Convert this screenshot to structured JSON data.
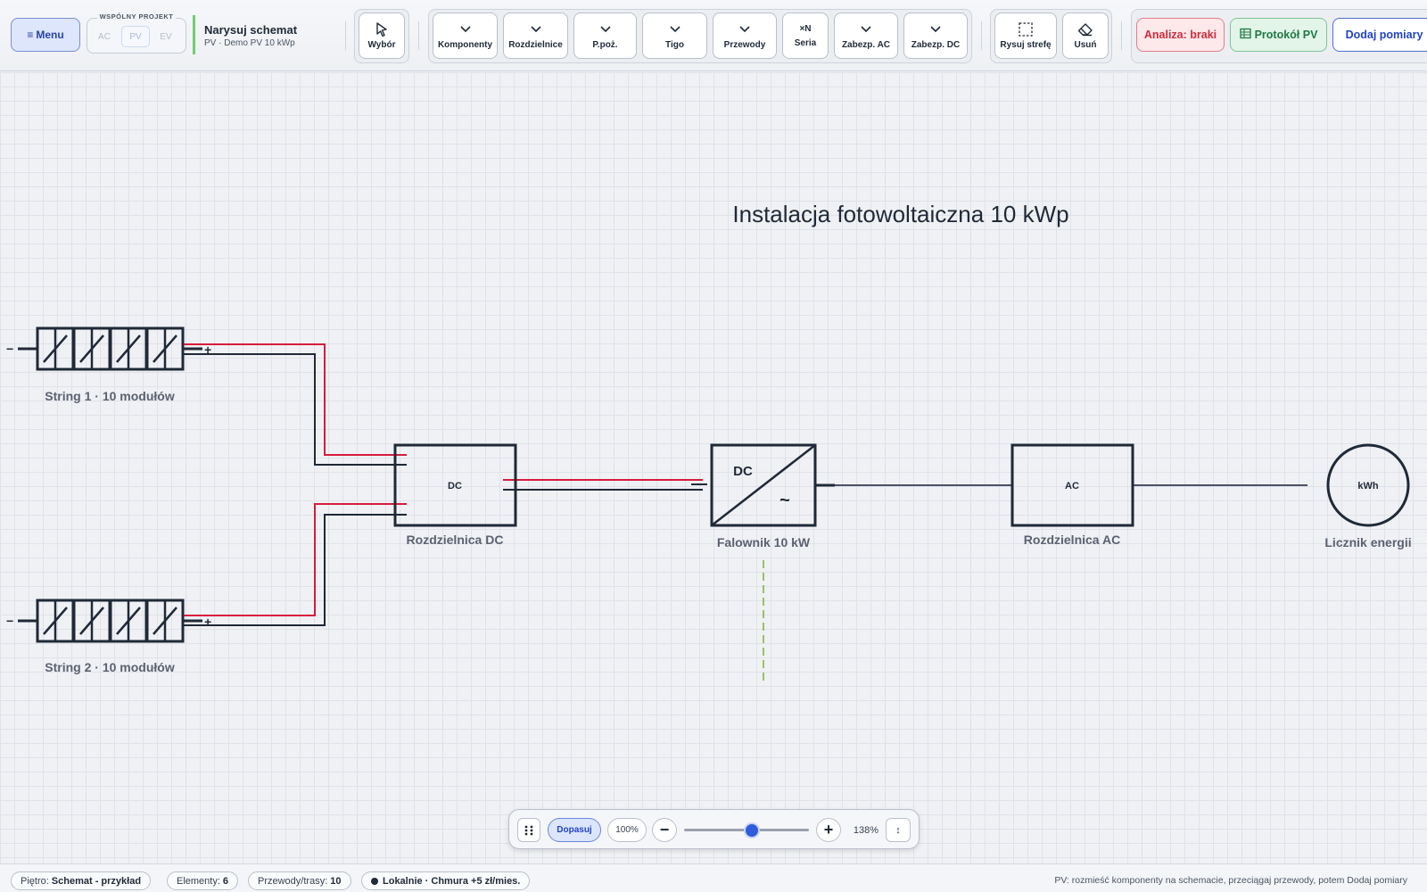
{
  "toolbar": {
    "menu_label": "Menu",
    "shared_project_label": "WSPÓLNY PROJEKT",
    "project_segments": [
      "AC",
      "PV",
      "EV"
    ],
    "active_segment": "PV",
    "title": "Narysuj schemat",
    "subtitle": "PV · Demo PV 10 kWp",
    "select_label": "Wybór",
    "components_label": "Komponenty",
    "switchboards_label": "Rozdzielnice",
    "fire_label": "P.poż.",
    "tigo_label": "Tigo",
    "wires_label": "Przewody",
    "series_top": "×N",
    "series_label": "Seria",
    "ac_protection_label": "Zabezp. AC",
    "dc_protection_label": "Zabezp. DC",
    "draw_zone_label": "Rysuj strefę",
    "delete_label": "Usuń",
    "analysis_label": "Analiza: braki",
    "protocol_label": "Protokół PV",
    "add_measurements_label": "Dodaj pomiary"
  },
  "diagram": {
    "title": "Instalacja fotowoltaiczna 10 kWp",
    "string1_label": "String 1 · 10 modułów",
    "string2_label": "String 2 · 10 modułów",
    "minus_sign": "−",
    "plus_sign": "+",
    "dc_box_text": "DC",
    "dc_box_label": "Rozdzielnica DC",
    "inverter_dc_text": "DC",
    "inverter_ac_text": "~",
    "inverter_label": "Falownik 10 kW",
    "ac_box_text": "AC",
    "ac_box_label": "Rozdzielnica AC",
    "meter_text": "kWh",
    "meter_label": "Licznik energii",
    "colors": {
      "positive_wire": "#d81b3c",
      "negative_wire": "#1f2937",
      "ac_line": "#4a5068",
      "ground_line": "#7fb03a"
    }
  },
  "zoom": {
    "fit_label": "Dopasuj",
    "reset_label": "100%",
    "minus_label": "−",
    "plus_label": "+",
    "level_text": "138%",
    "level_fraction": 0.55,
    "resize_label": "↕"
  },
  "status": {
    "floor_label": "Piętro:",
    "floor_value": "Schemat - przykład",
    "elements_label": "Elementy:",
    "elements_value": "6",
    "wires_label": "Przewody/trasy:",
    "wires_value": "10",
    "storage_text": "Lokalnie · Chmura +5 zł/mies.",
    "hint": "PV: rozmieść komponenty na schemacie, przeciągaj przewody, potem Dodaj pomiary"
  }
}
